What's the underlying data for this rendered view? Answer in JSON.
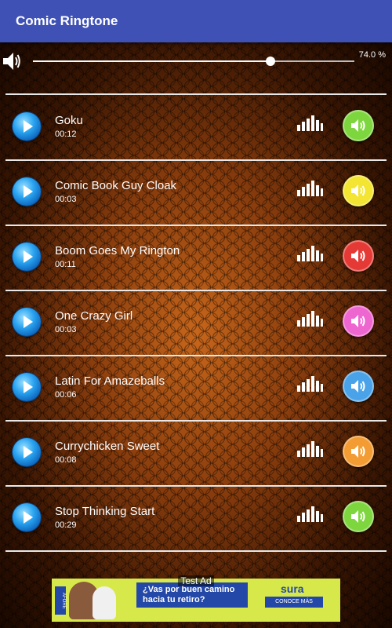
{
  "app": {
    "title": "Comic Ringtone"
  },
  "volume": {
    "percent_text": "74.0 %",
    "level": 0.74
  },
  "ringtones": [
    {
      "name": "Goku",
      "duration": "00:12",
      "speaker_color": "#7ed63f"
    },
    {
      "name": "Comic Book Guy Cloak",
      "duration": "00:03",
      "speaker_color": "#f3e531"
    },
    {
      "name": "Boom Goes My Rington",
      "duration": "00:11",
      "speaker_color": "#e53935"
    },
    {
      "name": "One Crazy Girl",
      "duration": "00:03",
      "speaker_color": "#ee66cf"
    },
    {
      "name": "Latin For Amazeballs",
      "duration": "00:06",
      "speaker_color": "#4aa3e8"
    },
    {
      "name": "Currychicken Sweet",
      "duration": "00:08",
      "speaker_color": "#f39c34"
    },
    {
      "name": "Stop Thinking Start",
      "duration": "00:29",
      "speaker_color": "#7ed63f"
    }
  ],
  "ad": {
    "label": "Test Ad",
    "headline": "¿Vas por buen camino hacia tu retiro?",
    "brand": "sura",
    "cta": "CONOCE MÁS",
    "side_text": "AFORE"
  },
  "icons": {
    "volume": "speaker-icon",
    "play": "play-icon",
    "bars": "equalizer-bars-icon",
    "speaker": "speaker-volume-icon"
  }
}
